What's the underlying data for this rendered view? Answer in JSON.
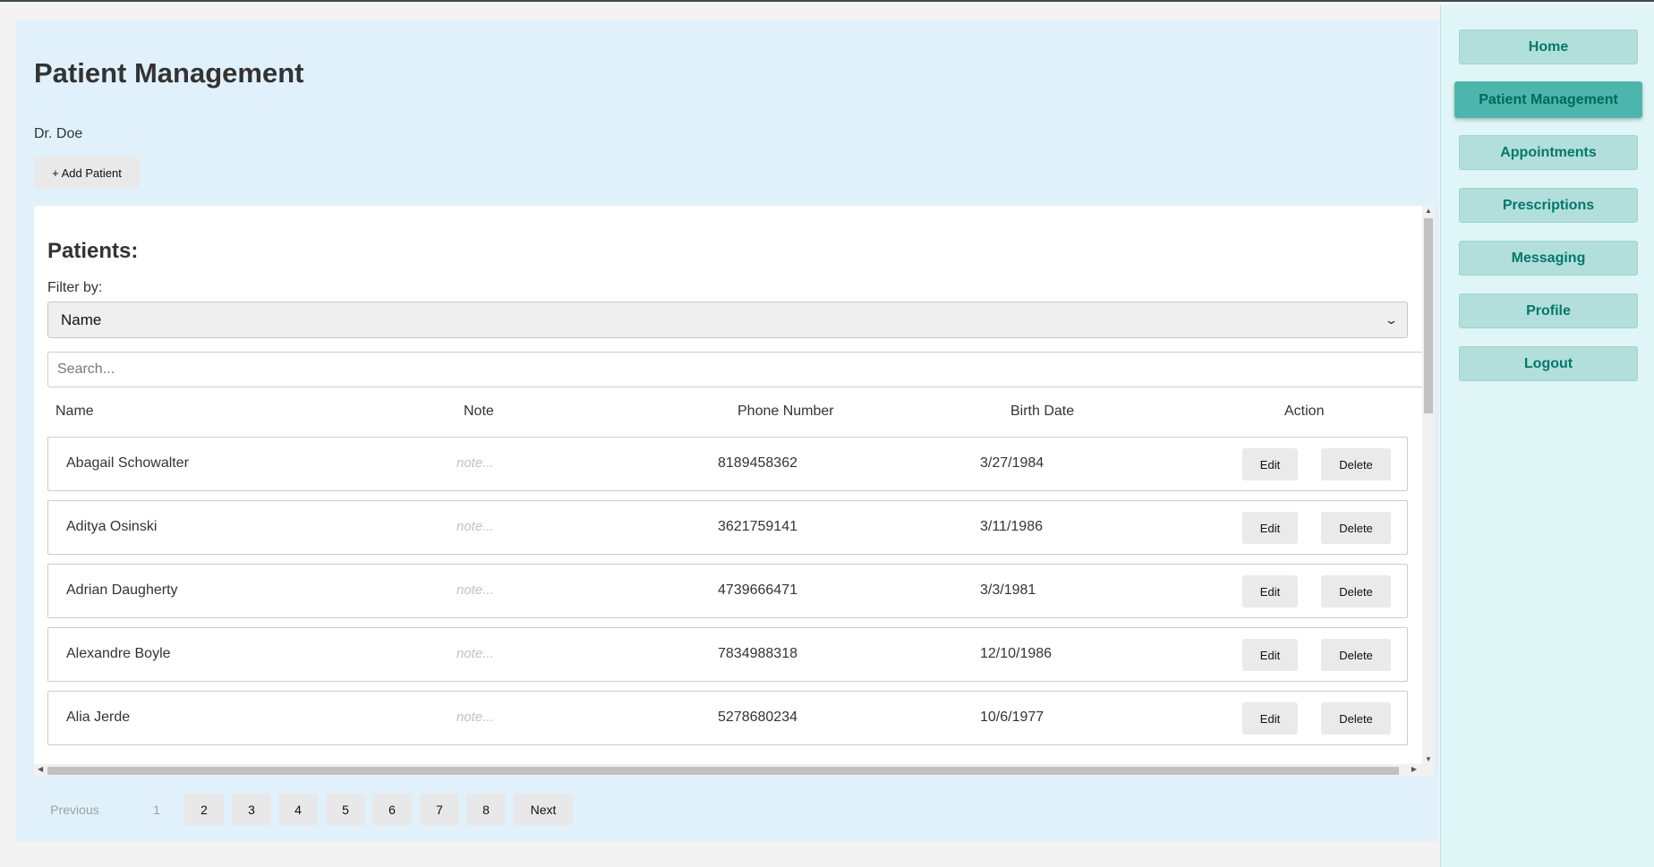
{
  "header": {
    "title": "Patient Management",
    "doctor_name": "Dr. Doe",
    "add_patient_label": "+ Add Patient"
  },
  "patients_panel": {
    "title": "Patients:",
    "filter_label": "Filter by:",
    "filter_value": "Name",
    "search_placeholder": "Search...",
    "columns": [
      "Name",
      "Note",
      "Phone Number",
      "Birth Date",
      "Action"
    ],
    "note_placeholder": "note...",
    "edit_label": "Edit",
    "delete_label": "Delete",
    "rows": [
      {
        "name": "Abagail Schowalter",
        "phone": "8189458362",
        "birth_date": "3/27/1984"
      },
      {
        "name": "Aditya Osinski",
        "phone": "3621759141",
        "birth_date": "3/11/1986"
      },
      {
        "name": "Adrian Daugherty",
        "phone": "4739666471",
        "birth_date": "3/3/1981"
      },
      {
        "name": "Alexandre Boyle",
        "phone": "7834988318",
        "birth_date": "12/10/1986"
      },
      {
        "name": "Alia Jerde",
        "phone": "5278680234",
        "birth_date": "10/6/1977"
      }
    ]
  },
  "pagination": {
    "previous_label": "Previous",
    "pages": [
      "1",
      "2",
      "3",
      "4",
      "5",
      "6",
      "7",
      "8"
    ],
    "current_page": "1",
    "next_label": "Next"
  },
  "sidebar": {
    "items": [
      {
        "label": "Home",
        "active": false
      },
      {
        "label": "Patient Management",
        "active": true
      },
      {
        "label": "Appointments",
        "active": false
      },
      {
        "label": "Prescriptions",
        "active": false
      },
      {
        "label": "Messaging",
        "active": false
      },
      {
        "label": "Profile",
        "active": false
      },
      {
        "label": "Logout",
        "active": false
      }
    ]
  },
  "colors": {
    "main_background": "#e1f1fb",
    "sidebar_background": "#e0f6f6",
    "nav_button": "#b2dfdb",
    "nav_button_active": "#4db6ac",
    "nav_text": "#00796b"
  }
}
